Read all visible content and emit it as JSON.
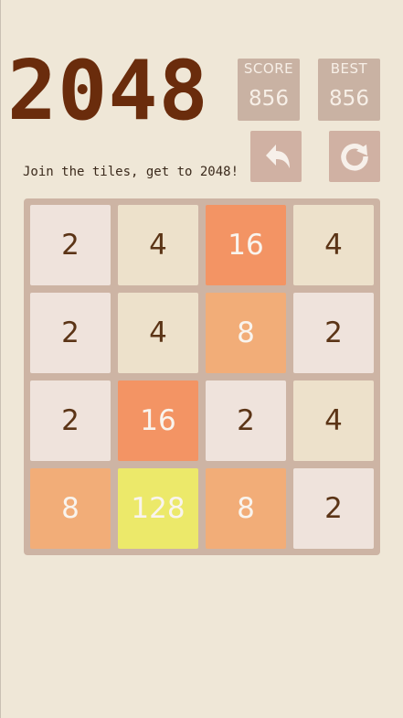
{
  "header": {
    "title": "2048",
    "subtitle": "Join the tiles, get to 2048!"
  },
  "score": {
    "label": "SCORE",
    "value": "856"
  },
  "best": {
    "label": "BEST",
    "value": "856"
  },
  "controls": {
    "undo_icon": "undo-arrow-icon",
    "restart_icon": "restart-icon"
  },
  "board": {
    "rows": [
      [
        "2",
        "4",
        "16",
        "4"
      ],
      [
        "2",
        "4",
        "8",
        "2"
      ],
      [
        "2",
        "16",
        "2",
        "4"
      ],
      [
        "8",
        "128",
        "8",
        "2"
      ]
    ]
  },
  "colors": {
    "background": "#efe7d7",
    "board": "#cdb4a4",
    "tile_2": "#efe3dc",
    "tile_4": "#ede1cb",
    "tile_8": "#f2ad78",
    "tile_16": "#f39464",
    "tile_128": "#ece96a",
    "title": "#6a2c0c"
  }
}
